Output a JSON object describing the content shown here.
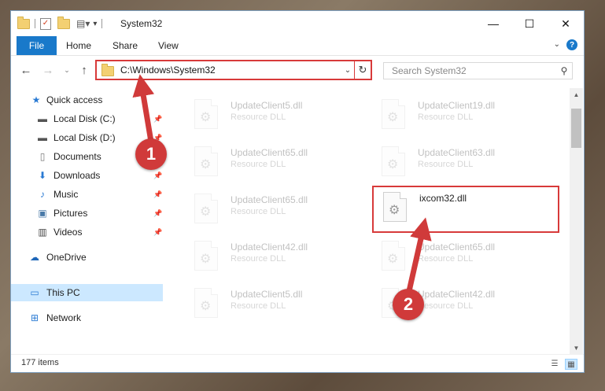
{
  "window": {
    "title": "System32",
    "controls": {
      "minimize": "—",
      "maximize": "☐",
      "close": "✕"
    }
  },
  "ribbon": {
    "file": "File",
    "tabs": [
      "Home",
      "Share",
      "View"
    ]
  },
  "address": {
    "path": "C:\\Windows\\System32",
    "search_placeholder": "Search System32"
  },
  "nav": {
    "items": [
      {
        "label": "Quick access",
        "icon": "star-icon"
      },
      {
        "label": "Local Disk (C:)",
        "icon": "drive-icon"
      },
      {
        "label": "Local Disk (D:)",
        "icon": "drive-icon"
      },
      {
        "label": "Documents",
        "icon": "documents-icon"
      },
      {
        "label": "Downloads",
        "icon": "download-arrow-icon"
      },
      {
        "label": "Music",
        "icon": "music-note-icon"
      },
      {
        "label": "Pictures",
        "icon": "pictures-icon"
      },
      {
        "label": "Videos",
        "icon": "film-icon"
      },
      {
        "label": "OneDrive",
        "icon": "cloud-icon"
      },
      {
        "label": "This PC",
        "icon": "computer-icon"
      },
      {
        "label": "Network",
        "icon": "network-icon"
      }
    ]
  },
  "files": [
    {
      "name": "UpdateClient5.dll",
      "type": "Resource DLL"
    },
    {
      "name": "UpdateClient19.dll",
      "type": "Resource DLL"
    },
    {
      "name": "UpdateClient65.dll",
      "type": "Resource DLL"
    },
    {
      "name": "UpdateClient63.dll",
      "type": "Resource DLL"
    },
    {
      "name": "UpdateClient65.dll",
      "type": "Resource DLL"
    },
    {
      "name": "ixcom32.dll",
      "type": ""
    },
    {
      "name": "UpdateClient42.dll",
      "type": "Resource DLL"
    },
    {
      "name": "UpdateClient65.dll",
      "type": "Resource DLL"
    },
    {
      "name": "UpdateClient5.dll",
      "type": "Resource DLL"
    },
    {
      "name": "UpdateClient42.dll",
      "type": "Resource DLL"
    }
  ],
  "status": {
    "item_count": "177 items"
  },
  "annotations": {
    "step1": "1",
    "step2": "2",
    "color": "#d03a3a"
  }
}
